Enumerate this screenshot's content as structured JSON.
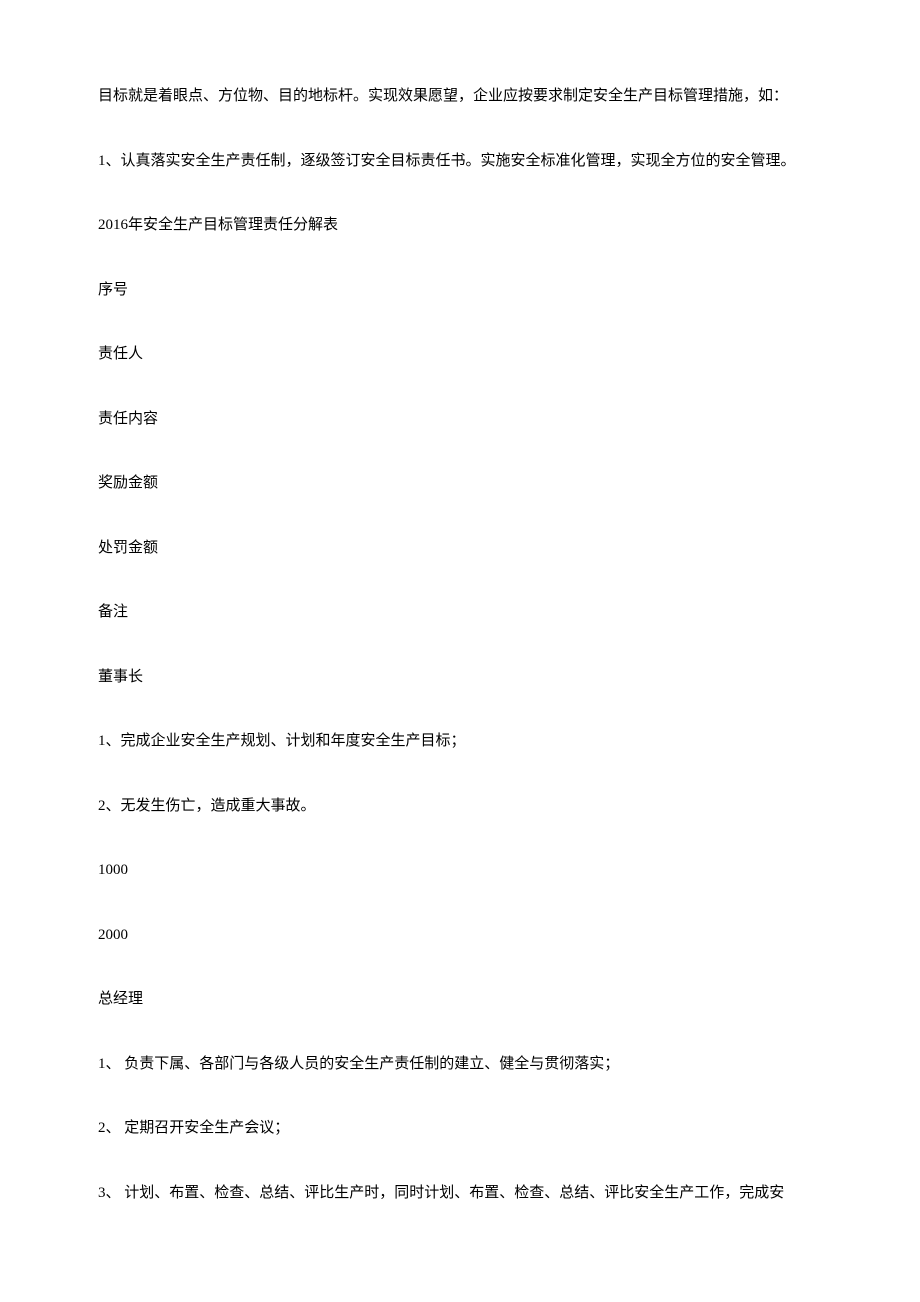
{
  "paragraphs": {
    "p1": "目标就是着眼点、方位物、目的地标杆。实现效果愿望，企业应按要求制定安全生产目标管理措施，如：",
    "p2": "1、认真落实安全生产责任制，逐级签订安全目标责任书。实施安全标准化管理，实现全方位的安全管理。",
    "p3": "2016年安全生产目标管理责任分解表",
    "p4": "序号",
    "p5": "责任人",
    "p6": "责任内容",
    "p7": "奖励金额",
    "p8": "处罚金额",
    "p9": "备注",
    "p10": "董事长",
    "p11": "1、完成企业安全生产规划、计划和年度安全生产目标；",
    "p12": "2、无发生伤亡，造成重大事故。",
    "p13": "1000",
    "p14": "2000",
    "p15": "总经理",
    "p16": "1、 负责下属、各部门与各级人员的安全生产责任制的建立、健全与贯彻落实；",
    "p17": "2、 定期召开安全生产会议；",
    "p18": "3、 计划、布置、检查、总结、评比生产时，同时计划、布置、检查、总结、评比安全生产工作，完成安"
  }
}
